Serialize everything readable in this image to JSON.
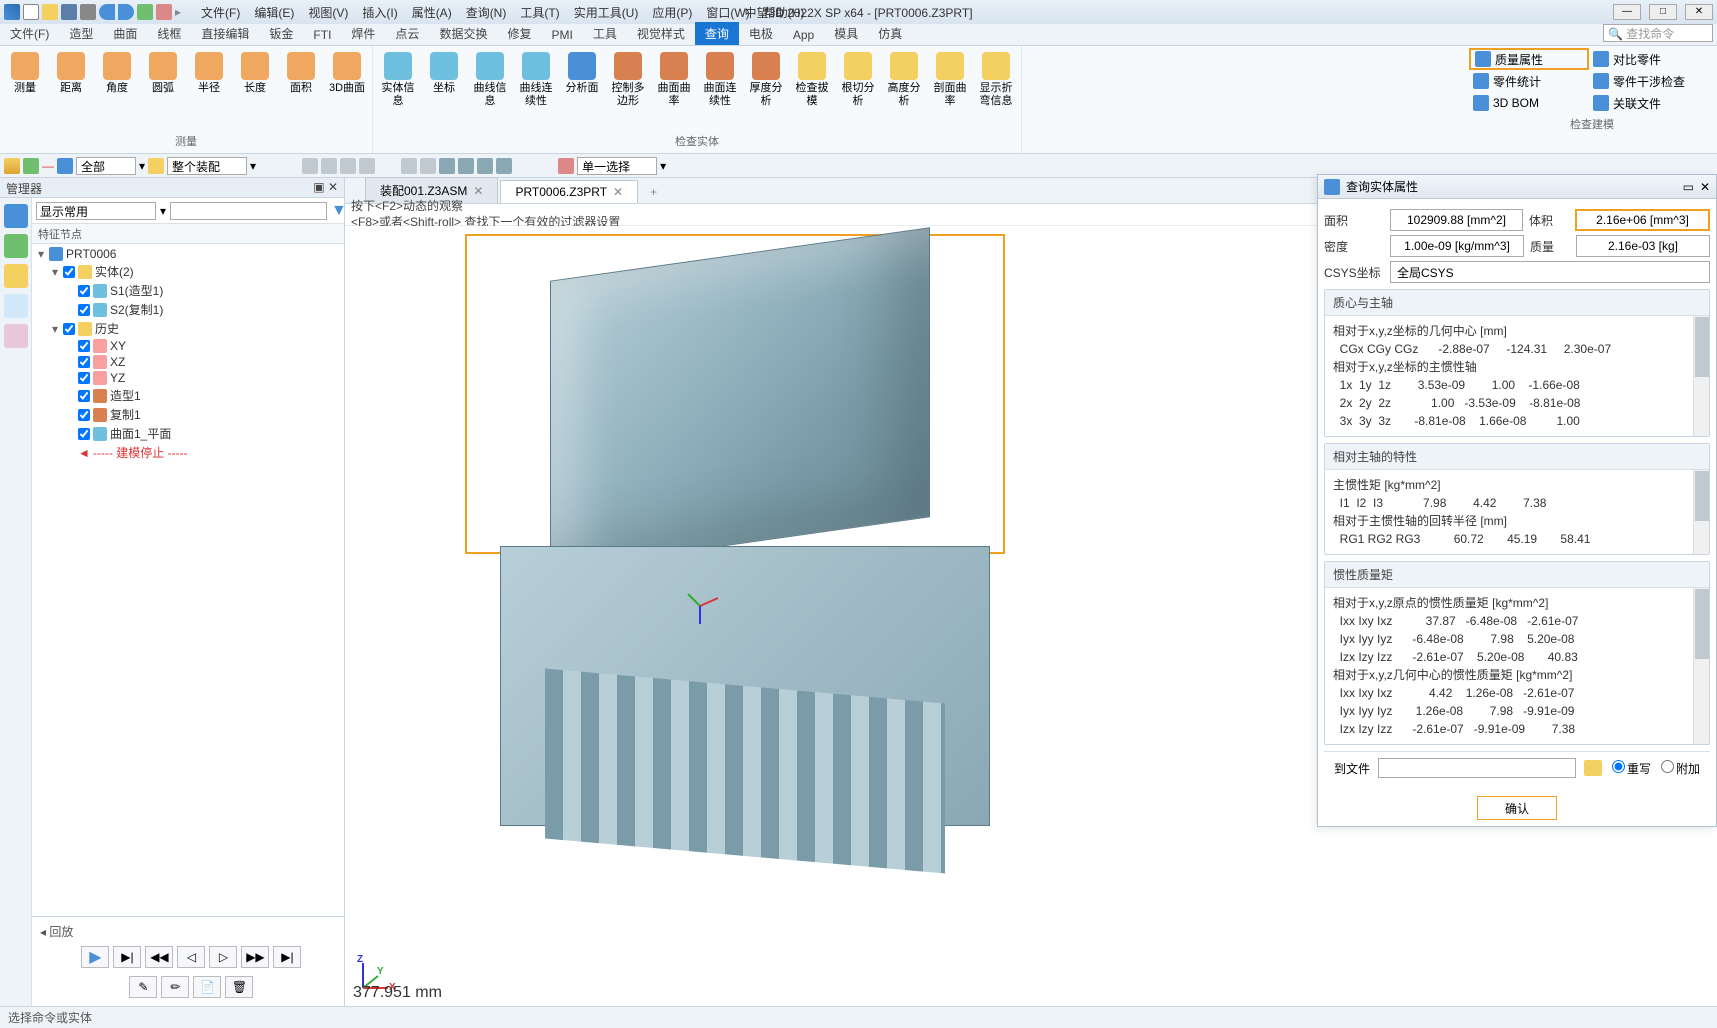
{
  "title": "中望3D 2022X SP x64 - [PRT0006.Z3PRT]",
  "menubar": [
    "文件(F)",
    "编辑(E)",
    "视图(V)",
    "插入(I)",
    "属性(A)",
    "查询(N)",
    "工具(T)",
    "实用工具(U)",
    "应用(P)",
    "窗口(W)",
    "帮助(H)"
  ],
  "search_placeholder": "查找命令",
  "tabs": [
    "文件(F)",
    "造型",
    "曲面",
    "线框",
    "直接编辑",
    "钣金",
    "FTI",
    "焊件",
    "点云",
    "数据交换",
    "修复",
    "PMI",
    "工具",
    "视觉样式",
    "查询",
    "电极",
    "App",
    "模具",
    "仿真"
  ],
  "active_tab": "查询",
  "ribbon": {
    "measure": {
      "label": "测量",
      "items": [
        "测量",
        "距离",
        "角度",
        "圆弧",
        "半径",
        "长度",
        "面积",
        "3D曲面"
      ]
    },
    "inspect": {
      "label": "检查实体",
      "items": [
        "实体信息",
        "坐标",
        "曲线信息",
        "曲线连续性",
        "分析面",
        "控制多边形",
        "曲面曲率",
        "曲面连续性",
        "厚度分析",
        "检查拔模",
        "根切分析",
        "高度分析",
        "剖面曲率",
        "显示折弯信息"
      ]
    },
    "right": [
      {
        "label": "质量属性",
        "hl": true
      },
      {
        "label": "对比零件"
      },
      {
        "label": "零件统计"
      },
      {
        "label": "零件干涉检查"
      },
      {
        "label": "3D BOM"
      },
      {
        "label": "关联文件"
      }
    ],
    "right_group_label": "检查建模"
  },
  "tb2": {
    "scope": "全部",
    "mode": "整个装配",
    "select": "单一选择"
  },
  "mgr_title": "管理器",
  "tree": {
    "display": "显示常用",
    "header": "特征节点",
    "root": "PRT0006",
    "solid": "实体(2)",
    "s1": "S1(造型1)",
    "s2": "S2(复制1)",
    "hist": "历史",
    "xy": "XY",
    "xz": "XZ",
    "yz": "YZ",
    "feat1": "造型1",
    "feat2": "复制1",
    "feat3": "曲面1_平面",
    "stop": "----- 建模停止 -----"
  },
  "playback": "回放",
  "doctabs": [
    {
      "label": "装配001.Z3ASM",
      "active": false
    },
    {
      "label": "PRT0006.Z3PRT",
      "active": true
    }
  ],
  "hints": [
    "按下<F2>动态的观察",
    "<F8>或者<Shift-roll> 查找下一个有效的过滤器设置"
  ],
  "dim": "377.951 mm",
  "panel": {
    "title": "查询实体属性",
    "area_l": "面积",
    "area_v": "102909.88 [mm^2]",
    "vol_l": "体积",
    "vol_v": "2.16e+06 [mm^3]",
    "dens_l": "密度",
    "dens_v": "1.00e-09 [kg/mm^3]",
    "mass_l": "质量",
    "mass_v": "2.16e-03 [kg]",
    "csys_l": "CSYS坐标",
    "csys_v": "全局CSYS",
    "sec1": "质心与主轴",
    "sec1_lines": [
      "相对于x,y,z坐标的几何中心 [mm]",
      "  CGx CGy CGz      -2.88e-07     -124.31     2.30e-07",
      "",
      "相对于x,y,z坐标的主惯性轴",
      "  1x  1y  1z        3.53e-09        1.00    -1.66e-08",
      "  2x  2y  2z            1.00   -3.53e-09    -8.81e-08",
      "  3x  3y  3z       -8.81e-08    1.66e-08         1.00"
    ],
    "sec2": "相对主轴的特性",
    "sec2_lines": [
      "主惯性矩 [kg*mm^2]",
      "  I1  I2  I3            7.98        4.42        7.38",
      "",
      "相对于主惯性轴的回转半径 [mm]",
      "  RG1 RG2 RG3          60.72       45.19       58.41"
    ],
    "sec3": "惯性质量矩",
    "sec3_lines": [
      "相对于x,y,z原点的惯性质量矩 [kg*mm^2]",
      "  Ixx Ixy Ixz          37.87   -6.48e-08   -2.61e-07",
      "  Iyx Iyy Iyz      -6.48e-08        7.98    5.20e-08",
      "  Izx Izy Izz      -2.61e-07    5.20e-08       40.83",
      "",
      "相对于x,y,z几何中心的惯性质量矩 [kg*mm^2]",
      "  Ixx Ixy Ixz           4.42    1.26e-08   -2.61e-07",
      "  Iyx Iyy Iyz       1.26e-08        7.98   -9.91e-09",
      "  Izx Izy Izz      -2.61e-07   -9.91e-09        7.38"
    ],
    "tofile": "到文件",
    "overwrite": "重写",
    "append": "附加",
    "ok": "确认"
  },
  "status": "选择命令或实体"
}
